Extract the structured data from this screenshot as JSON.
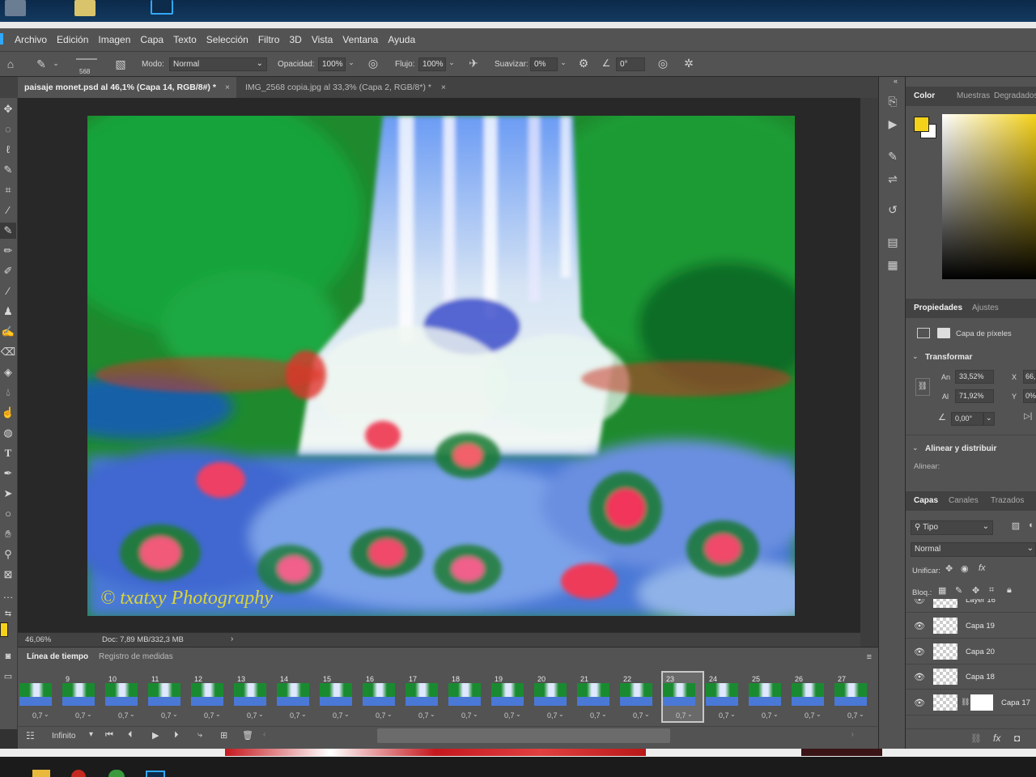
{
  "menu": [
    "Archivo",
    "Edición",
    "Imagen",
    "Capa",
    "Texto",
    "Selección",
    "Filtro",
    "3D",
    "Vista",
    "Ventana",
    "Ayuda"
  ],
  "options": {
    "brush_size": "568",
    "mode_label": "Modo:",
    "mode_value": "Normal",
    "opacity_label": "Opacidad:",
    "opacity_value": "100%",
    "flow_label": "Flujo:",
    "flow_value": "100%",
    "smooth_label": "Suavizar:",
    "smooth_value": "0%",
    "angle_value": "0°"
  },
  "tabs": [
    {
      "label": "paisaje monet.psd al 46,1% (Capa 14, RGB/8#) *",
      "active": true
    },
    {
      "label": "IMG_2568 copia.jpg al 33,3% (Capa 2, RGB/8*) *",
      "active": false
    }
  ],
  "canvas": {
    "watermark": "© txatxy Photography"
  },
  "status": {
    "zoom": "46,06%",
    "doc": "Doc: 7,89 MB/332,3 MB"
  },
  "timeline": {
    "tab_timeline": "Línea de tiempo",
    "tab_measure": "Registro de medidas",
    "frames": [
      "",
      "9",
      "10",
      "11",
      "12",
      "13",
      "14",
      "15",
      "16",
      "17",
      "18",
      "19",
      "20",
      "21",
      "22",
      "23",
      "24",
      "25",
      "26",
      "27"
    ],
    "duration": "0,7",
    "selected_frame": "23",
    "loop": "Infinito"
  },
  "color_panel": {
    "tabs": [
      "Color",
      "Muestras",
      "Degradados"
    ],
    "foreground": "#f5d21a",
    "background": "#ffffff"
  },
  "properties": {
    "tabs": [
      "Propiedades",
      "Ajustes"
    ],
    "kind": "Capa de píxeles",
    "transform_title": "Transformar",
    "w_label": "An",
    "w_value": "33,52%",
    "h_label": "Al",
    "h_value": "71,92%",
    "x_label": "X",
    "x_value": "66,",
    "y_label": "Y",
    "y_value": "0%",
    "angle_value": "0,00°",
    "align_title": "Alinear y distribuir",
    "align_label": "Alinear:"
  },
  "layers_panel": {
    "tabs": [
      "Capas",
      "Canales",
      "Trazados"
    ],
    "filter": "Tipo",
    "blend": "Normal",
    "unify_label": "Unificar:",
    "lock_label": "Bloq.:",
    "layers": [
      "Layer 16",
      "Capa 19",
      "Capa 20",
      "Capa 18",
      "Capa 17"
    ]
  }
}
